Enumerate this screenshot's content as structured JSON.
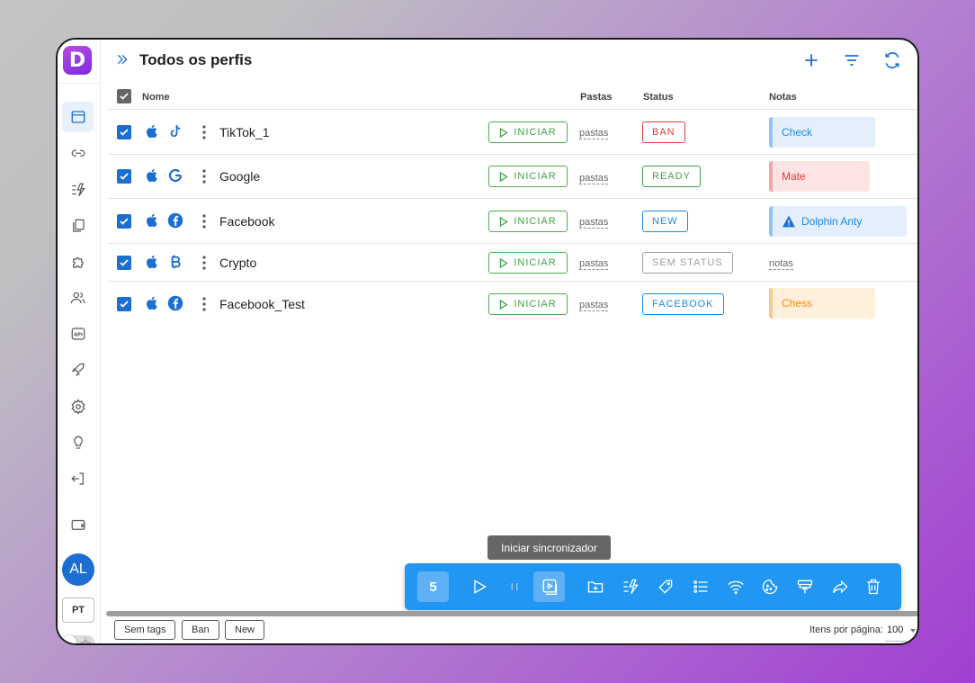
{
  "app": {
    "logo_letter": "D",
    "brand_colors": {
      "primary": "#1c6fd1",
      "accent": "#2196f3",
      "logo": "#9b3fe0"
    }
  },
  "header": {
    "title": "Todos os perfis",
    "actions": [
      "plus-icon",
      "filter-icon",
      "refresh-icon"
    ]
  },
  "sidebar": {
    "items": [
      "browser-icon",
      "link-icon",
      "automation-icon",
      "copy-icon",
      "puzzle-icon",
      "users-icon",
      "api-icon",
      "rocket-icon",
      "gear-icon",
      "lightbulb-icon",
      "logout-icon",
      "wallet-icon"
    ],
    "api_label": "API",
    "avatar": "AL",
    "language": "PT"
  },
  "table": {
    "columns": {
      "name": "Nome",
      "folders": "Pastas",
      "status": "Status",
      "notes": "Notas"
    },
    "start_label": "INICIAR",
    "folders_placeholder": "pastas",
    "rows": [
      {
        "name": "TikTok_1",
        "platform_icon": "tiktok-icon",
        "status": "BAN",
        "status_color": "#e53935",
        "note": "Check",
        "note_color": "#1e88e5",
        "note_bg": "#e3effc",
        "note_bar": "#90c2f5"
      },
      {
        "name": "Google",
        "platform_icon": "google-icon",
        "status": "READY",
        "status_color": "#43a047",
        "note": "Mate",
        "note_color": "#e53935",
        "note_bg": "#fde4e4",
        "note_bar": "#f5a3a3"
      },
      {
        "name": "Facebook",
        "platform_icon": "facebook-icon",
        "status": "NEW",
        "status_color": "#1e88e5",
        "note": "Dolphin Anty",
        "note_color": "#1e88e5",
        "note_bg": "#e3effc",
        "note_bar": "#90c2f5"
      },
      {
        "name": "Crypto",
        "platform_icon": "bitcoin-icon",
        "status": "SEM STATUS",
        "status_color": "#9e9e9e",
        "note": "notas"
      },
      {
        "name": "Facebook_Test",
        "platform_icon": "facebook-icon",
        "status": "FACEBOOK",
        "status_color": "#1e88e5",
        "note": "Chess",
        "note_color": "#fb8c00",
        "note_bg": "#fff0dc",
        "note_bar": "#fbc98a"
      }
    ]
  },
  "toolbar": {
    "selected_count": "5",
    "tooltip": "Iniciar sincronizador",
    "buttons": [
      "play-icon",
      "pause-icon",
      "sync-icon",
      "folder-add-icon",
      "automation-icon",
      "tag-icon",
      "list-icon",
      "wifi-icon",
      "cookie-icon",
      "export-icon",
      "share-icon",
      "trash-icon"
    ]
  },
  "footer": {
    "tags": [
      "Sem tags",
      "Ban",
      "New"
    ],
    "items_per_page_label": "Itens por página:",
    "items_per_page_value": "100"
  }
}
